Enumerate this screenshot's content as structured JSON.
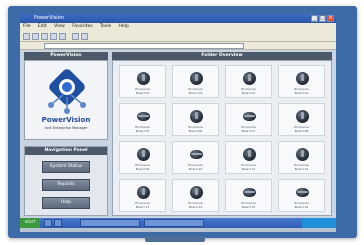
{
  "window": {
    "title": "PowerVision",
    "menu": [
      "File",
      "Edit",
      "View",
      "Favorites",
      "Tools",
      "Help"
    ]
  },
  "left_panel": {
    "header": "PowerVision",
    "logo_title": "PowerVision",
    "logo_subtitle": "Unit Enterprise Manager"
  },
  "navigation": {
    "header": "Navigation Panel",
    "items": [
      "System Status",
      "Reports",
      "Help"
    ]
  },
  "folder_overview": {
    "header": "Folder Overview",
    "tiles": [
      {
        "line1": "Enclosure",
        "line2": "Board 01",
        "shape": "round"
      },
      {
        "line1": "Enclosure",
        "line2": "Board 02",
        "shape": "round"
      },
      {
        "line1": "Enclosure",
        "line2": "Board 03",
        "shape": "round"
      },
      {
        "line1": "Enclosure",
        "line2": "Board 04",
        "shape": "round"
      },
      {
        "line1": "Enclosure",
        "line2": "Board 05",
        "shape": "flat"
      },
      {
        "line1": "Enclosure",
        "line2": "Board 06",
        "shape": "round"
      },
      {
        "line1": "Enclosure",
        "line2": "Board 07",
        "shape": "flat"
      },
      {
        "line1": "Enclosure",
        "line2": "Board 08",
        "shape": "round"
      },
      {
        "line1": "Enclosure",
        "line2": "Board 09",
        "shape": "round"
      },
      {
        "line1": "Enclosure",
        "line2": "Board 10",
        "shape": "flat"
      },
      {
        "line1": "Enclosure",
        "line2": "Board 11",
        "shape": "round"
      },
      {
        "line1": "Enclosure",
        "line2": "Board 12",
        "shape": "round"
      },
      {
        "line1": "Enclosure",
        "line2": "Board 13",
        "shape": "round"
      },
      {
        "line1": "Enclosure",
        "line2": "Board 14",
        "shape": "round"
      },
      {
        "line1": "Enclosure",
        "line2": "Board 15",
        "shape": "flat"
      },
      {
        "line1": "Enclosure",
        "line2": "Board 16",
        "shape": "flat"
      }
    ]
  },
  "taskbar": {
    "start_label": "start"
  },
  "colors": {
    "monitor_frame": "#3d6ba8",
    "panel_header": "#4b5968",
    "logo_blue": "#22489a",
    "taskbar": "#2f5db2"
  }
}
